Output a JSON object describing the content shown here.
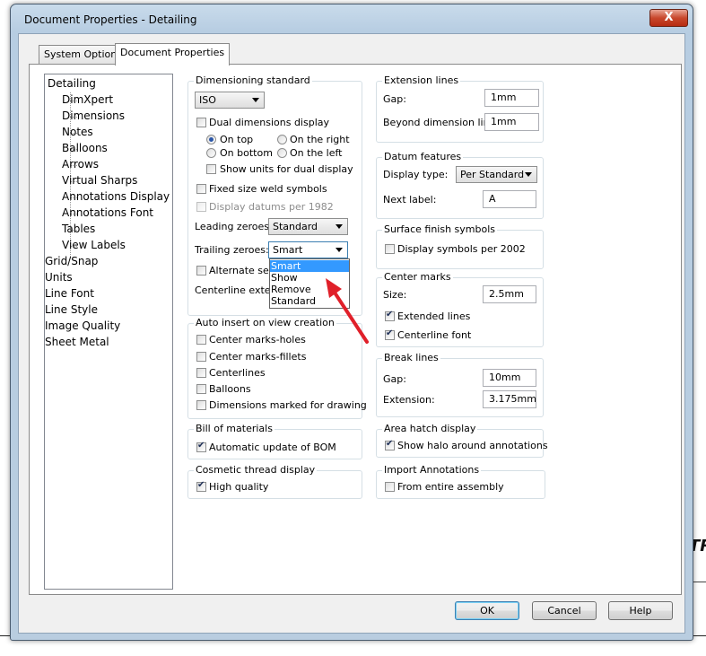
{
  "window": {
    "title": "Document Properties - Detailing",
    "close_label": "X"
  },
  "tabs": [
    {
      "label": "System Options"
    },
    {
      "label": "Document Properties"
    }
  ],
  "tree": {
    "items": [
      {
        "label": "Detailing"
      },
      {
        "label": "DimXpert"
      },
      {
        "label": "Dimensions"
      },
      {
        "label": "Notes"
      },
      {
        "label": "Balloons"
      },
      {
        "label": "Arrows"
      },
      {
        "label": "Virtual Sharps"
      },
      {
        "label": "Annotations Display"
      },
      {
        "label": "Annotations Font"
      },
      {
        "label": "Tables"
      },
      {
        "label": "View Labels"
      },
      {
        "label": "Grid/Snap"
      },
      {
        "label": "Units"
      },
      {
        "label": "Line Font"
      },
      {
        "label": "Line Style"
      },
      {
        "label": "Image Quality"
      },
      {
        "label": "Sheet Metal"
      }
    ]
  },
  "dimensioning": {
    "title": "Dimensioning standard",
    "standard_value": "ISO",
    "dual_display": {
      "label": "Dual dimensions display",
      "checked": false
    },
    "on_top": {
      "label": "On top",
      "checked": true
    },
    "on_right": {
      "label": "On the right",
      "checked": false
    },
    "on_bottom": {
      "label": "On bottom",
      "checked": false
    },
    "on_left": {
      "label": "On the left",
      "checked": false
    },
    "show_units": {
      "label": "Show units for dual display",
      "checked": false
    },
    "fixed_weld": {
      "label": "Fixed size weld symbols",
      "checked": false
    },
    "datums_1982": {
      "label": "Display datums per 1982",
      "checked": false
    },
    "leading_label": "Leading zeroes:",
    "leading_value": "Standard",
    "trailing_label": "Trailing zeroes:",
    "trailing_value": "Smart",
    "trailing_options": [
      "Smart",
      "Show",
      "Remove",
      "Standard"
    ],
    "alternate_label": "Alternate sec",
    "centerline_label": "Centerline exten"
  },
  "auto_insert": {
    "title": "Auto insert on view creation",
    "items": [
      {
        "label": "Center marks-holes",
        "checked": false
      },
      {
        "label": "Center marks-fillets",
        "checked": false
      },
      {
        "label": "Centerlines",
        "checked": false
      },
      {
        "label": "Balloons",
        "checked": false
      },
      {
        "label": "Dimensions marked for drawing",
        "checked": false
      }
    ]
  },
  "bom": {
    "title": "Bill of materials",
    "item": {
      "label": "Automatic update of BOM",
      "checked": true
    }
  },
  "cosmetic": {
    "title": "Cosmetic thread display",
    "item": {
      "label": "High quality",
      "checked": true
    }
  },
  "extension_lines": {
    "title": "Extension lines",
    "gap_label": "Gap:",
    "gap_value": "1mm",
    "beyond_label": "Beyond dimension line:",
    "beyond_value": "1mm"
  },
  "datum": {
    "title": "Datum features",
    "display_label": "Display type:",
    "display_value": "Per Standard",
    "next_label": "Next label:",
    "next_value": "A"
  },
  "surface": {
    "title": "Surface finish symbols",
    "item": {
      "label": "Display symbols per 2002",
      "checked": false
    }
  },
  "center_marks": {
    "title": "Center marks",
    "size_label": "Size:",
    "size_value": "2.5mm",
    "extended": {
      "label": "Extended lines",
      "checked": true
    },
    "centerline_font": {
      "label": "Centerline font",
      "checked": true
    }
  },
  "break_lines": {
    "title": "Break lines",
    "gap_label": "Gap:",
    "gap_value": "10mm",
    "ext_label": "Extension:",
    "ext_value": "3.175mm"
  },
  "area_hatch": {
    "title": "Area hatch display",
    "item": {
      "label": "Show halo around annotations",
      "checked": true
    }
  },
  "import_ann": {
    "title": "Import Annotations",
    "item": {
      "label": "From entire assembly",
      "checked": false
    }
  },
  "buttons": {
    "ok": "OK",
    "cancel": "Cancel",
    "help": "Help"
  },
  "annotation": {
    "arrow_color": "#e0202a"
  }
}
